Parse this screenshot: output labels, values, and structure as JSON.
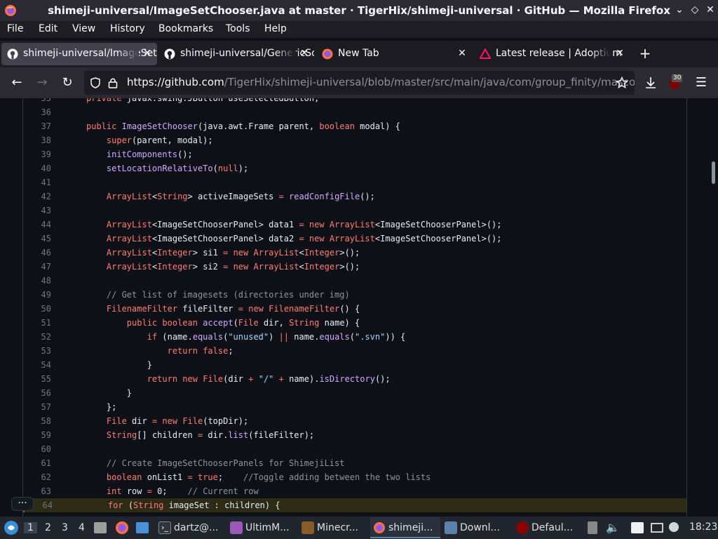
{
  "window": {
    "title": "shimeji-universal/ImageSetChooser.java at master · TigerHix/shimeji-universal · GitHub — Mozilla Firefox",
    "minimize": "⌄",
    "maximize": "◇",
    "close": "✕"
  },
  "menu": [
    "File",
    "Edit",
    "View",
    "History",
    "Bookmarks",
    "Tools",
    "Help"
  ],
  "tabs": [
    {
      "label": "shimeji-universal/ImageSetChooser.java",
      "icon": "github-icon",
      "active": true
    },
    {
      "label": "shimeji-universal/GenericSomething",
      "icon": "github-icon",
      "active": false
    },
    {
      "label": "New Tab",
      "icon": "firefox-icon",
      "active": false
    },
    {
      "label": "Latest release | Adoptium",
      "icon": "adoptium-icon",
      "active": false
    }
  ],
  "new_tab": "+",
  "nav": {
    "back": "←",
    "forward": "→",
    "reload": "↻",
    "url_host": "https://github.com",
    "url_path": "/TigerHix/shimeji-universal/blob/master/src/main/java/com/group_finity/mascot/",
    "ublock_badge": "30"
  },
  "code": {
    "partial_top": "private javax.swing.JButton useSelectedButton;",
    "lines": [
      {
        "n": "36",
        "t": ""
      },
      {
        "n": "37",
        "t": "public ImageSetChooser(java.awt.Frame parent, boolean modal) {"
      },
      {
        "n": "38",
        "t": "    super(parent, modal);"
      },
      {
        "n": "39",
        "t": "    initComponents();"
      },
      {
        "n": "40",
        "t": "    setLocationRelativeTo(null);"
      },
      {
        "n": "41",
        "t": ""
      },
      {
        "n": "42",
        "t": "    ArrayList<String> activeImageSets = readConfigFile();"
      },
      {
        "n": "43",
        "t": ""
      },
      {
        "n": "44",
        "t": "    ArrayList<ImageSetChooserPanel> data1 = new ArrayList<ImageSetChooserPanel>();"
      },
      {
        "n": "45",
        "t": "    ArrayList<ImageSetChooserPanel> data2 = new ArrayList<ImageSetChooserPanel>();"
      },
      {
        "n": "46",
        "t": "    ArrayList<Integer> si1 = new ArrayList<Integer>();"
      },
      {
        "n": "47",
        "t": "    ArrayList<Integer> si2 = new ArrayList<Integer>();"
      },
      {
        "n": "48",
        "t": ""
      },
      {
        "n": "49",
        "t": "    // Get list of imagesets (directories under img)"
      },
      {
        "n": "50",
        "t": "    FilenameFilter fileFilter = new FilenameFilter() {"
      },
      {
        "n": "51",
        "t": "        public boolean accept(File dir, String name) {"
      },
      {
        "n": "52",
        "t": "            if (name.equals(\"unused\") || name.equals(\".svn\")) {"
      },
      {
        "n": "53",
        "t": "                return false;"
      },
      {
        "n": "54",
        "t": "            }"
      },
      {
        "n": "55",
        "t": "            return new File(dir + \"/\" + name).isDirectory();"
      },
      {
        "n": "56",
        "t": "        }"
      },
      {
        "n": "57",
        "t": "    };"
      },
      {
        "n": "58",
        "t": "    File dir = new File(topDir);"
      },
      {
        "n": "59",
        "t": "    String[] children = dir.list(fileFilter);"
      },
      {
        "n": "60",
        "t": ""
      },
      {
        "n": "61",
        "t": "    // Create ImageSetChooserPanels for ShimejiList"
      },
      {
        "n": "62",
        "t": "    boolean onList1 = true;    //Toggle adding between the two lists"
      },
      {
        "n": "63",
        "t": "    int row = 0;    // Current row"
      },
      {
        "n": "64",
        "t": "    for (String imageSet : children) {"
      }
    ],
    "highlighted": "64"
  },
  "more_button": "···",
  "taskbar": {
    "workspaces": [
      "1",
      "2",
      "3",
      "4"
    ],
    "items": [
      {
        "label": "dartz@...",
        "icon": "terminal-icon"
      },
      {
        "label": "UltimM...",
        "icon": "app-icon"
      },
      {
        "label": "Minecr...",
        "icon": "minecraft-icon"
      },
      {
        "label": "shimeji...",
        "icon": "firefox-icon",
        "active": true
      },
      {
        "label": "Downl...",
        "icon": "folder-icon"
      },
      {
        "label": "Defaul...",
        "icon": "wine-icon"
      }
    ],
    "clock": "18:23"
  },
  "colors": {
    "page_bg": "#0d1117",
    "chrome": "#2b2a33",
    "keyword": "#ff7b72",
    "function": "#d2a8ff",
    "comment": "#8b949e",
    "string": "#a5d6ff"
  }
}
